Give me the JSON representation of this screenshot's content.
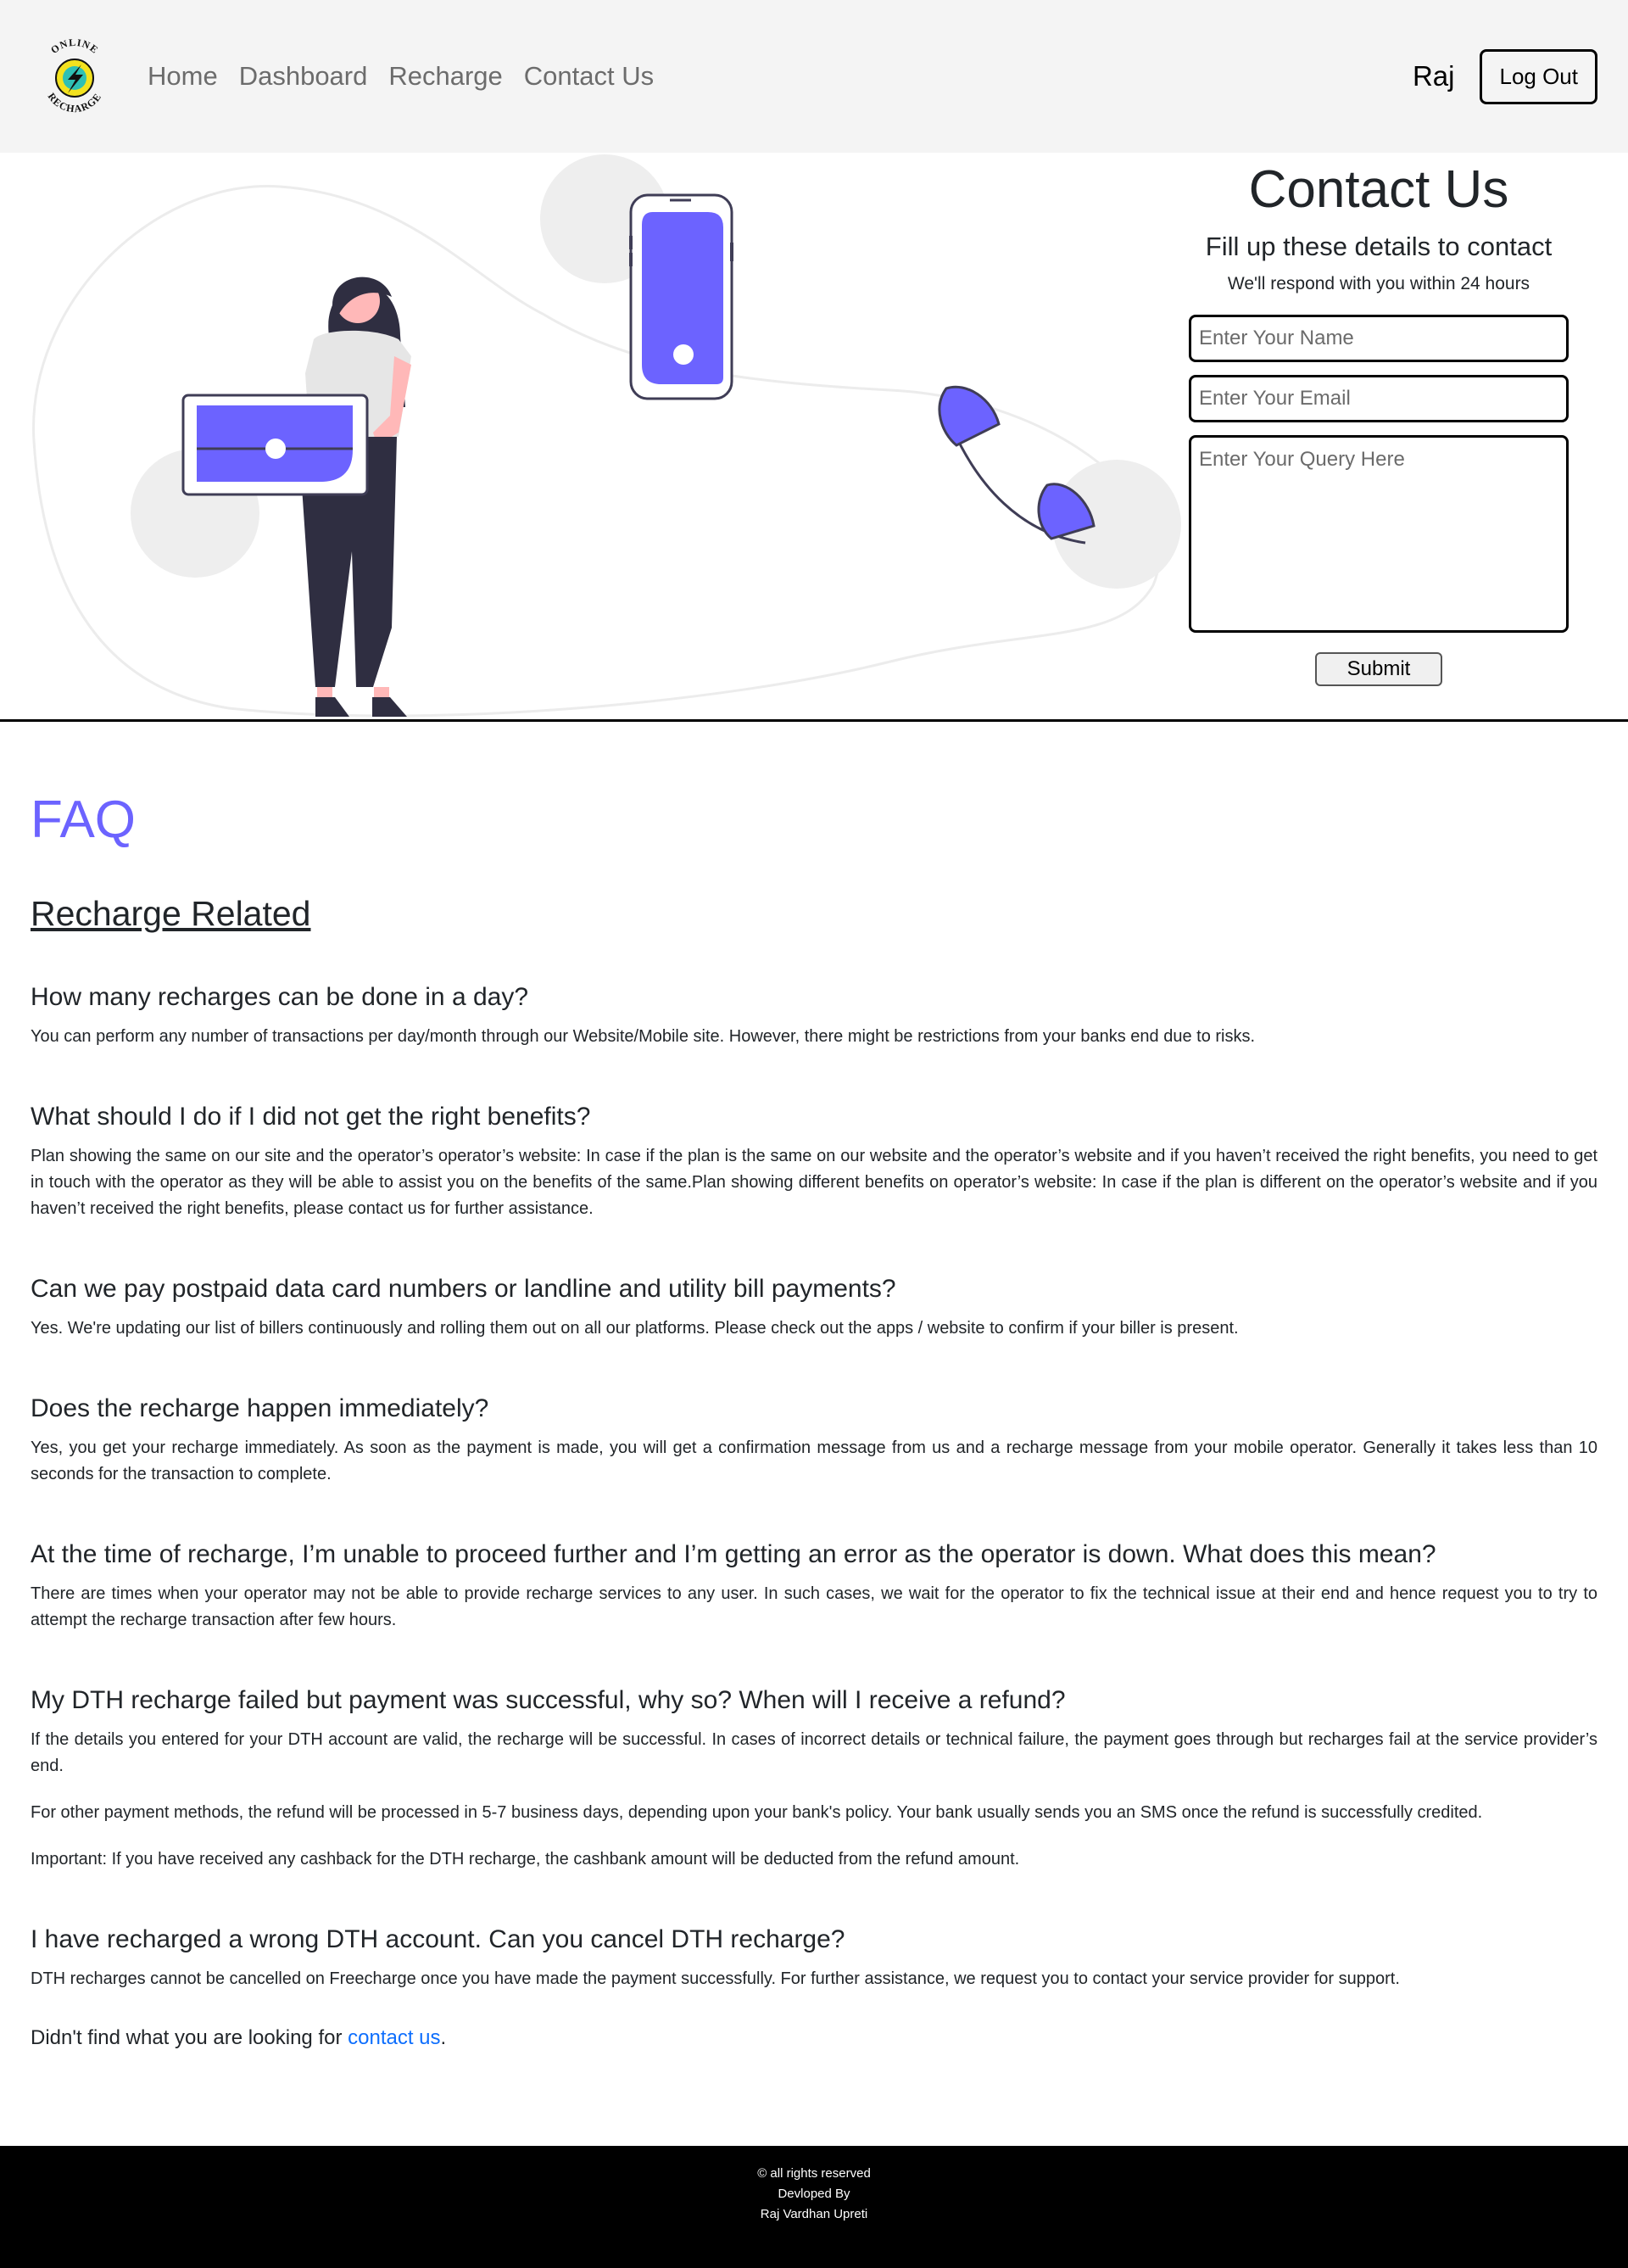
{
  "nav": {
    "logo_text_top": "ONLINE",
    "logo_text_bottom": "RECHARGE",
    "links": [
      "Home",
      "Dashboard",
      "Recharge",
      "Contact Us"
    ],
    "user": "Raj",
    "logout_label": "Log Out"
  },
  "contact": {
    "title": "Contact Us",
    "subtitle": "Fill up these details to contact",
    "note": "We'll respond with you within 24 hours",
    "name_placeholder": "Enter Your Name",
    "email_placeholder": "Enter Your Email",
    "query_placeholder": "Enter Your Query Here",
    "submit_label": "Submit"
  },
  "faq": {
    "title": "FAQ",
    "section_title": "Recharge Related",
    "items": [
      {
        "q": "How many recharges can be done in a day?",
        "a": [
          "You can perform any number of transactions per day/month through our Website/Mobile site. However, there might be restrictions from your banks end due to risks."
        ]
      },
      {
        "q": "What should I do if I did not get the right benefits?",
        "a": [
          "Plan showing the same on our site and the operator’s operator’s website: In case if the plan is the same on our website and the operator’s website and if you haven’t received the right benefits, you need to get in touch with the operator as they will be able to assist you on the benefits of the same.Plan showing different benefits on operator’s website: In case if the plan is different on the operator’s website and if you haven’t received the right benefits, please contact us for further assistance."
        ]
      },
      {
        "q": "Can we pay postpaid data card numbers or landline and utility bill payments?",
        "a": [
          "Yes. We're updating our list of billers continuously and rolling them out on all our platforms. Please check out the apps / website to confirm if your biller is present."
        ]
      },
      {
        "q": "Does the recharge happen immediately?",
        "a": [
          "Yes, you get your recharge immediately. As soon as the payment is made, you will get a confirmation message from us and a recharge message from your mobile operator. Generally it takes less than 10 seconds for the transaction to complete."
        ]
      },
      {
        "q": "At the time of recharge, I’m unable to proceed further and I’m getting an error as the operator is down. What does this mean?",
        "a": [
          "There are times when your operator may not be able to provide recharge services to any user. In such cases, we wait for the operator to fix the technical issue at their end and hence request you to try to attempt the recharge transaction after few hours."
        ]
      },
      {
        "q": "My DTH recharge failed but payment was successful, why so? When will I receive a refund?",
        "a": [
          "If the details you entered for your DTH account are valid, the recharge will be successful. In cases of incorrect details or technical failure, the payment goes through but recharges fail at the service provider’s end.",
          "For other payment methods, the refund will be processed in 5-7 business days, depending upon your bank's policy. Your bank usually sends you an SMS once the refund is successfully credited.",
          "Important: If you have received any cashback for the DTH recharge, the cashbank amount will be deducted from the refund amount."
        ]
      },
      {
        "q": "I have recharged a wrong DTH account. Can you cancel DTH recharge?",
        "a": [
          "DTH recharges cannot be cancelled on Freecharge once you have made the payment successfully. For further assistance, we request you to contact your service provider for support."
        ]
      }
    ],
    "end_text": "Didn't find what you are looking for",
    "end_link": "contact us",
    "end_suffix": "."
  },
  "footer": {
    "line1": "© all rights reserved",
    "line2": "Devloped By",
    "line3": "Raj Vardhan Upreti"
  },
  "colors": {
    "accent": "#6c63ff",
    "navbar_bg": "#f4f4f4",
    "footer_bg": "#000000",
    "link": "#0d6efd"
  }
}
